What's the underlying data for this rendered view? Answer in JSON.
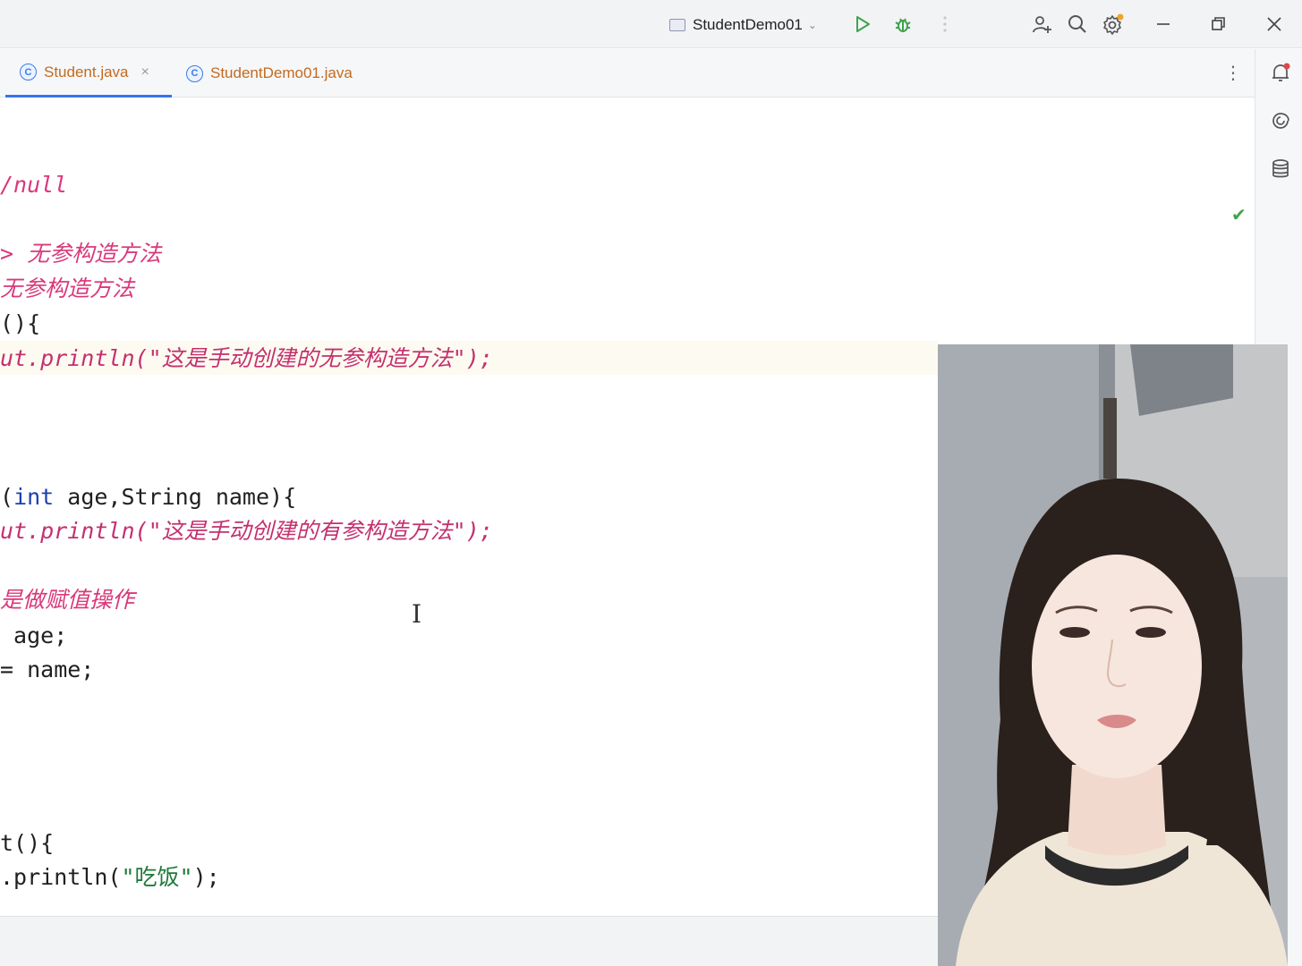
{
  "titlebar": {
    "run_config": "StudentDemo01"
  },
  "tabs": [
    {
      "label": "Student.java",
      "active": true
    },
    {
      "label": "StudentDemo01.java",
      "active": false
    }
  ],
  "editor": {
    "lines": [
      {
        "text": "/null",
        "kind": "comment"
      },
      {
        "text": "> 无参构造方法",
        "kind": "comment"
      },
      {
        "text": "无参构造方法",
        "kind": "comment"
      },
      {
        "text": "(){",
        "kind": "plain"
      },
      {
        "pre": "ut.println(",
        "str": "\"这是手动创建的无参构造方法\"",
        "post": ");",
        "kind": "string-line"
      },
      {
        "pre": "(",
        "kw": "int",
        "post": " age,String name){",
        "kind": "keyword-line"
      },
      {
        "pre": "ut.println(",
        "str": "\"这是手动创建的有参构造方法\"",
        "post": ");",
        "kind": "string-line"
      },
      {
        "text": "是做赋值操作",
        "kind": "comment"
      },
      {
        "text": " age;",
        "kind": "plain"
      },
      {
        "text": "= name;",
        "kind": "plain"
      },
      {
        "text": "t(){",
        "kind": "plain"
      },
      {
        "pre": ".println(",
        "str": "\"吃饭\"",
        "post": ");",
        "kind": "plain-string-line"
      }
    ]
  },
  "colors": {
    "comment": "#d9387a",
    "keyword": "#1d3fb0",
    "tab_text": "#c36a1f",
    "accent": "#3574f0"
  },
  "icons": {
    "titlebar": [
      "window-icon",
      "run-icon",
      "debug-icon",
      "more-vert-icon",
      "add-user-icon",
      "search-icon",
      "settings-icon",
      "minimize-icon",
      "restore-icon",
      "close-icon"
    ],
    "right_strip": [
      "notifications-icon",
      "ai-assistant-icon",
      "database-icon"
    ]
  }
}
